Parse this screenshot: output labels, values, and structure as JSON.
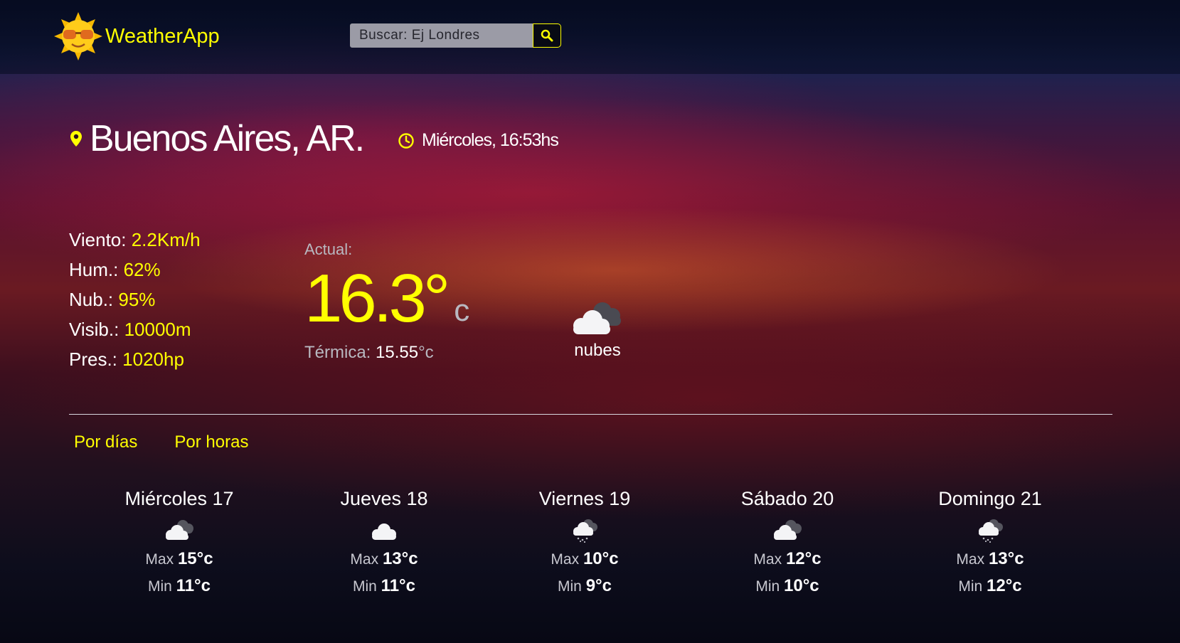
{
  "header": {
    "logo_text": "WeatherApp",
    "logo_icon": "sun-with-sunglasses-icon",
    "search_placeholder": "Buscar: Ej Londres",
    "search_icon": "search-icon"
  },
  "location": {
    "city": "Buenos Aires, AR.",
    "datetime": "Miércoles, 16:53hs"
  },
  "stats": [
    {
      "label": "Viento:",
      "value": "2.2Km/h"
    },
    {
      "label": "Hum.:",
      "value": "62%"
    },
    {
      "label": "Nub.:",
      "value": "95%"
    },
    {
      "label": "Visib.:",
      "value": "10000m"
    },
    {
      "label": "Pres.:",
      "value": "1020hp"
    }
  ],
  "current": {
    "label": "Actual:",
    "temp": "16.3°",
    "unit": "c",
    "feels_label": "Térmica:",
    "feels_value": "15.55",
    "feels_unit": "°c",
    "condition": "nubes",
    "condition_icon": "broken-clouds-icon"
  },
  "tabs": [
    "Por días",
    "Por horas"
  ],
  "forecast": [
    {
      "day": "Miércoles 17",
      "icon": "broken-clouds-icon",
      "max_label": "Max",
      "max": "15°c",
      "min_label": "Min",
      "min": "11°c"
    },
    {
      "day": "Jueves 18",
      "icon": "cloud-icon",
      "max_label": "Max",
      "max": "13°c",
      "min_label": "Min",
      "min": "11°c"
    },
    {
      "day": "Viernes 19",
      "icon": "rain-cloud-icon",
      "max_label": "Max",
      "max": "10°c",
      "min_label": "Min",
      "min": "9°c"
    },
    {
      "day": "Sábado 20",
      "icon": "broken-clouds-icon",
      "max_label": "Max",
      "max": "12°c",
      "min_label": "Min",
      "min": "10°c"
    },
    {
      "day": "Domingo 21",
      "icon": "rain-cloud-icon",
      "max_label": "Max",
      "max": "13°c",
      "min_label": "Min",
      "min": "12°c"
    }
  ],
  "colors": {
    "accent": "#ffff00",
    "text": "#ffffff",
    "muted": "#b8b8c0"
  }
}
